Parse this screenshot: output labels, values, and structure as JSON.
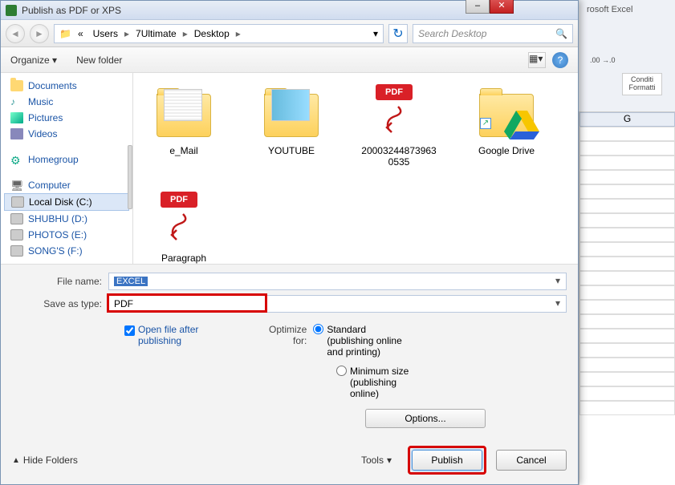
{
  "window": {
    "title": "Publish as PDF or XPS"
  },
  "excel": {
    "app": "rosoft Excel",
    "cond": "Conditi",
    "fmt": "Formatti",
    "col": "G"
  },
  "breadcrumb": {
    "segs": [
      "Users",
      "7Ultimate",
      "Desktop"
    ]
  },
  "search": {
    "placeholder": "Search Desktop"
  },
  "toolbar": {
    "organize": "Organize ▾",
    "newfolder": "New folder"
  },
  "sidebar": {
    "libs": [
      "Documents",
      "Music",
      "Pictures",
      "Videos"
    ],
    "homegroup": "Homegroup",
    "computer": "Computer",
    "drives": [
      "Local Disk (C:)",
      "SHUBHU (D:)",
      "PHOTOS (E:)",
      "SONG'S (F:)"
    ]
  },
  "files": {
    "items": [
      {
        "name": "e_Mail"
      },
      {
        "name": "YOUTUBE"
      },
      {
        "name": "20003244873963\n0535"
      },
      {
        "name": "Google Drive"
      },
      {
        "name": "Paragraph"
      }
    ]
  },
  "form": {
    "filename_label": "File name:",
    "filename_value": "EXCEL",
    "saveas_label": "Save as type:",
    "saveas_value": "PDF",
    "open_after": "Open file after publishing",
    "optimize_label": "Optimize for:",
    "opt_standard": "Standard (publishing online and printing)",
    "opt_min": "Minimum size (publishing online)",
    "options_btn": "Options...",
    "tools": "Tools",
    "publish": "Publish",
    "cancel": "Cancel",
    "hide": "Hide Folders"
  }
}
